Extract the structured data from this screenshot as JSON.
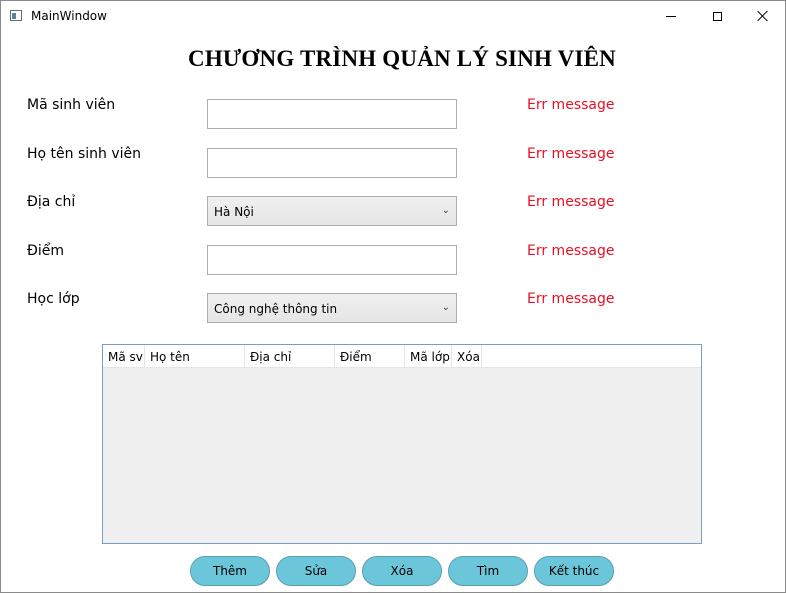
{
  "window": {
    "title": "MainWindow"
  },
  "heading": "CHƯƠNG TRÌNH QUẢN LÝ SINH VIÊN",
  "form": {
    "student_id": {
      "label": "Mã sinh viên",
      "value": "",
      "error": "Err message"
    },
    "full_name": {
      "label": "Họ tên sinh viên",
      "value": "",
      "error": "Err message"
    },
    "address": {
      "label": "Địa chỉ",
      "selected": "Hà Nội",
      "error": "Err message"
    },
    "score": {
      "label": "Điểm",
      "value": "",
      "error": "Err message"
    },
    "class": {
      "label": "Học lớp",
      "selected": "Công nghệ thông tin",
      "error": "Err message"
    }
  },
  "grid": {
    "columns": [
      "Mã sv",
      "Họ tên",
      "Địa chỉ",
      "Điểm",
      "Mã lớp",
      "Xóa"
    ],
    "rows": []
  },
  "buttons": {
    "add": "Thêm",
    "edit": "Sửa",
    "delete": "Xóa",
    "search": "Tìm",
    "exit": "Kết thúc"
  },
  "colors": {
    "error": "#e81123",
    "button": "#6cc6d9",
    "grid_border": "#7a9cc6"
  },
  "icons": {
    "app": "app-window-icon",
    "minimize": "minimize-icon",
    "maximize": "maximize-icon",
    "close": "close-icon",
    "dropdown": "chevron-down-icon"
  }
}
